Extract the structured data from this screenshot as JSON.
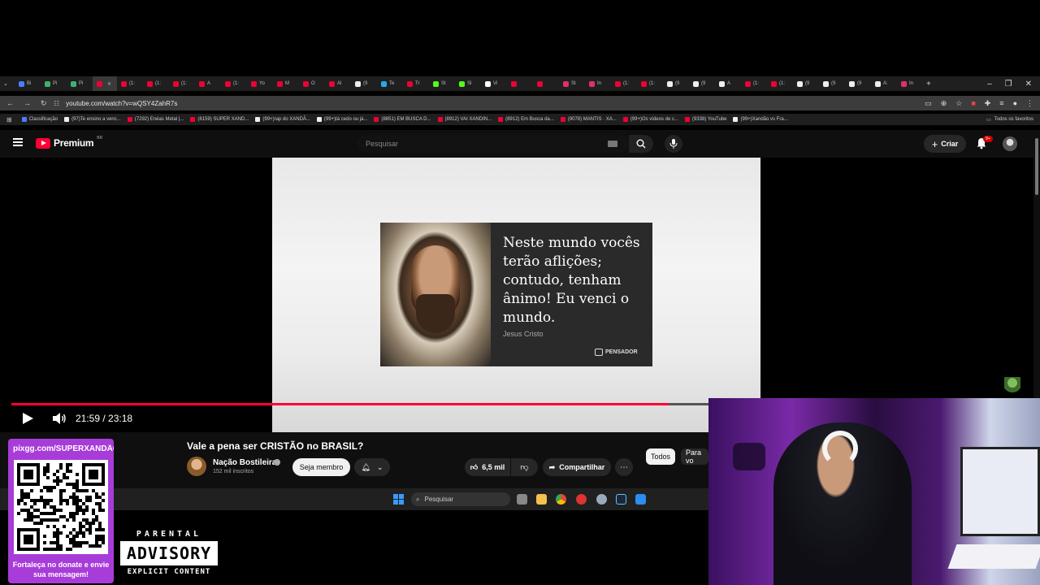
{
  "browser": {
    "tabs": [
      "Bi",
      "Pi",
      "Pi",
      "",
      "(1:",
      "(1:",
      "(1:",
      "A",
      "(1:",
      "Yo",
      "M",
      "O",
      "Al",
      "(9",
      "Te",
      "Tr",
      "St",
      "Sl",
      "Vi",
      "",
      "",
      "St",
      "In",
      "(1:",
      "(1:",
      "(9",
      "(9",
      "A",
      "(1:",
      "(1:",
      "(9",
      "(9",
      "(9",
      "A:",
      "In"
    ],
    "url": "youtube.com/watch?v=wQSY4ZahR7s",
    "bookmarks": [
      "Classificação",
      "(97)Te ensino a venc...",
      "(7292) Enéas Metal |...",
      "(8159) SUPER XAND...",
      "(99+)rap do XANDÃ...",
      "(99+)tá cedo ou já...",
      "(8851) EM BUSCA D...",
      "(8912) VAI XANDIN...",
      "(8912) Em Busca da...",
      "(9078) MANTIS · XA...",
      "(99+)Os vídeos de c...",
      "(9338) YouTube",
      "(99+)Xandão vs Fra..."
    ],
    "all_bookmarks": "Todos os favoritos"
  },
  "youtube": {
    "logo_text": "Premium",
    "country": "BR",
    "search_placeholder": "Pesquisar",
    "create_label": "Criar",
    "notification_count": "9+"
  },
  "video": {
    "quote": "Neste mundo vocês terão aflições; contudo, tenham ânimo! Eu venci o mundo.",
    "quote_author": "Jesus Cristo",
    "quote_source": "PENSADOR",
    "time_display": "21:59 / 23:18",
    "progress": 0.943
  },
  "watch": {
    "title": "Vale a pena ser CRISTÃO no BRASIL?",
    "channel_name": "Nação Bostileira",
    "subscribers": "152 mil inscritos",
    "member_label": "Seja membro",
    "likes": "6,5 mil",
    "share_label": "Compartilhar",
    "chips": [
      "Todos",
      "Para vo"
    ]
  },
  "taskbar": {
    "search_label": "Pesquisar"
  },
  "overlay": {
    "qr_url": "pixgg.com/SUPERXANDÃO",
    "qr_message": "Fortaleça no donate e envie sua mensagem!",
    "parental_top": "PARENTAL",
    "parental_mid": "ADVISORY",
    "parental_bottom": "EXPLICIT CONTENT"
  },
  "colors": {
    "yt_red": "#ff0033",
    "qr_panel": "#a73cd8",
    "bg": "#0f0f0f"
  }
}
